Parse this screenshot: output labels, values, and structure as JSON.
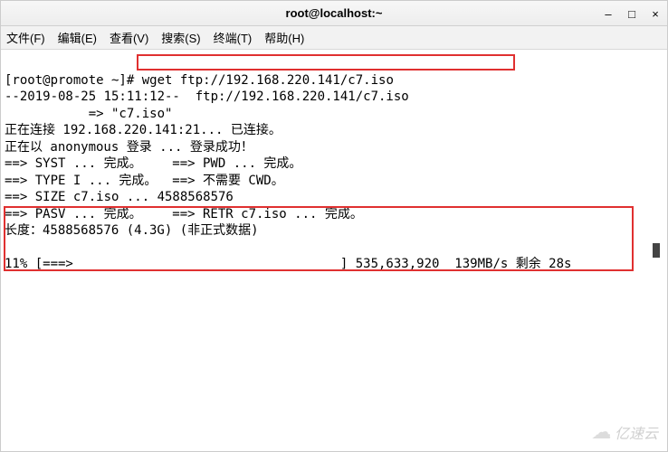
{
  "window": {
    "title": "root@localhost:~"
  },
  "menu": {
    "file": "文件(F)",
    "edit": "编辑(E)",
    "view": "查看(V)",
    "search": "搜索(S)",
    "terminal": "终端(T)",
    "help": "帮助(H)"
  },
  "terminal": {
    "line1_prompt": "[root@promote ~]# ",
    "line1_cmd": "wget ftp://192.168.220.141/c7.iso",
    "line2": "--2019-08-25 15:11:12--  ftp://192.168.220.141/c7.iso",
    "line3": "           => \"c7.iso\"",
    "line4": "正在连接 192.168.220.141:21... 已连接。",
    "line5": "正在以 anonymous 登录 ... 登录成功！",
    "line6": "==> SYST ... 完成。    ==> PWD ... 完成。",
    "line7": "==> TYPE I ... 完成。  ==> 不需要 CWD。",
    "line8": "==> SIZE c7.iso ... 4588568576",
    "line9": "==> PASV ... 完成。    ==> RETR c7.iso ... 完成。",
    "line10": "长度：4588568576 (4.3G) (非正式数据)",
    "line_blank": "",
    "line12": "11% [===>                                   ] 535,633,920  139MB/s 剩余 28s"
  },
  "wget": {
    "timestamp": "2019-08-25 15:11:12",
    "url": "ftp://192.168.220.141/c7.iso",
    "output_file": "c7.iso",
    "host": "192.168.220.141",
    "port": 21,
    "user": "anonymous",
    "size_bytes": 4588568576,
    "size_human": "4.3G",
    "progress_percent": 11,
    "downloaded_bytes": "535,633,920",
    "speed": "139MB/s",
    "eta": "28s"
  },
  "watermark": {
    "text": "亿速云"
  }
}
